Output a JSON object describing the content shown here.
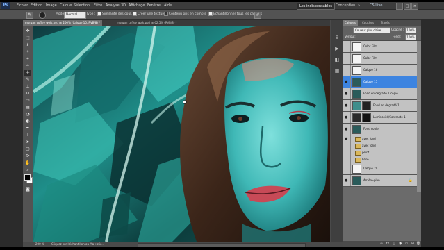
{
  "menubar": {
    "logo": "Ps",
    "items": [
      "Fichier",
      "Edition",
      "Image",
      "Calque",
      "Sélection",
      "Filtre",
      "Analyse",
      "3D",
      "Affichage",
      "Fenêtre",
      "Aide"
    ],
    "workspaces": {
      "active": "Les indispensables",
      "other": "Conception"
    },
    "cs_live": "CS Live"
  },
  "options": {
    "mode_label": "Mode :",
    "mode_value": "Normal",
    "opacity_label": "Opac. :",
    "opacity_value": "100%",
    "tolerance_label": "Toler. :",
    "similarity_label": "Similarité des coul.",
    "create_texture": "Créer une texture",
    "proximity": "Contenu pris en compte",
    "sample_all": "Echantillonner tous les calques"
  },
  "tabs": [
    {
      "label": "morgan coffey wolk.psd @ 200% (Calque 15, RVB/8) *"
    },
    {
      "label": "morgan coffey wolk.psd @ 62,5% (RVB/8) *"
    }
  ],
  "status": {
    "zoom": "200 %",
    "info": "Cliquez sur l'échantillon ou Maj+clic..."
  },
  "layers_panel": {
    "tabs": [
      "Calques",
      "Couches",
      "Tracés"
    ],
    "blend_mode": "Couleur plus claire",
    "opacity_label": "Opacité :",
    "opacity_value": "100%",
    "lock_label": "Verrou :",
    "fill_label": "Fond :",
    "fill_value": "100%",
    "layers": [
      {
        "name": "Color Film",
        "selected": false,
        "kind": "thumb"
      },
      {
        "name": "Color Film",
        "selected": false,
        "kind": "thumb"
      },
      {
        "name": "Calque 16",
        "selected": false,
        "kind": "thumb"
      },
      {
        "name": "Calque 15",
        "selected": true,
        "kind": "figure"
      },
      {
        "name": "Fond en dégradé 1 copie",
        "selected": false,
        "kind": "figure"
      },
      {
        "name": "Fond en dégradé 1",
        "selected": false,
        "kind": "double"
      },
      {
        "name": "Luminosité/Contraste 1",
        "selected": false,
        "kind": "double"
      },
      {
        "name": "Fond copie",
        "selected": false,
        "kind": "figure"
      },
      {
        "name": "avec fond",
        "selected": false,
        "kind": "folder"
      },
      {
        "name": "avec fond",
        "selected": false,
        "kind": "folder"
      },
      {
        "name": "peint",
        "selected": false,
        "kind": "folder"
      },
      {
        "name": "base",
        "selected": false,
        "kind": "folder"
      },
      {
        "name": "Calque 20",
        "selected": false,
        "kind": "thumb"
      },
      {
        "name": "Arrière-plan",
        "selected": false,
        "kind": "figure",
        "locked": true
      }
    ]
  },
  "colors": {
    "selected_layer": "#3d84e0",
    "canvas_teal": "#2fb5b0"
  }
}
